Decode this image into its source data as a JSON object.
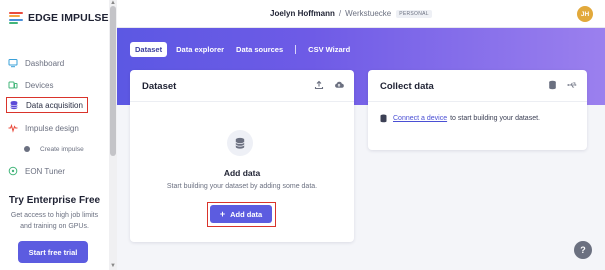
{
  "app": {
    "logo_text": "EDGE IMPULSE",
    "logo_colors": [
      "#e94b3c",
      "#f4a742",
      "#4a8fd8",
      "#43b57a"
    ]
  },
  "sidebar": {
    "items": [
      {
        "label": "Dashboard",
        "icon": "monitor-icon"
      },
      {
        "label": "Devices",
        "icon": "devices-icon"
      },
      {
        "label": "Data acquisition",
        "icon": "database-icon",
        "active": true
      },
      {
        "label": "Impulse design",
        "icon": "pulse-icon"
      },
      {
        "label": "Create impulse",
        "icon": "dot-icon",
        "sub": true
      },
      {
        "label": "EON Tuner",
        "icon": "tuner-icon"
      }
    ],
    "trial": {
      "title": "Try Enterprise Free",
      "text": "Get access to high job limits and training on GPUs.",
      "button": "Start free trial"
    }
  },
  "header": {
    "user_name": "Joelyn Hoffmann",
    "separator": "/",
    "project_name": "Werkstuecke",
    "badge": "PERSONAL",
    "avatar_initials": "JH",
    "avatar_color": "#e2a93b"
  },
  "tabs": [
    {
      "label": "Dataset",
      "active": true
    },
    {
      "label": "Data explorer"
    },
    {
      "label": "Data sources"
    },
    {
      "label": "CSV Wizard"
    }
  ],
  "dataset_card": {
    "title": "Dataset",
    "actions": [
      "upload-icon",
      "cloud-upload-icon"
    ],
    "empty_title": "Add data",
    "empty_desc": "Start building your dataset by adding some data.",
    "add_button": "Add data"
  },
  "collect_card": {
    "title": "Collect data",
    "actions": [
      "device-icon",
      "usb-icon"
    ],
    "link_text": "Connect a device",
    "suffix_text": "to start building your dataset."
  },
  "help_label": "?",
  "colors": {
    "accent": "#5c5ce0",
    "highlight_border": "#d9342b"
  }
}
